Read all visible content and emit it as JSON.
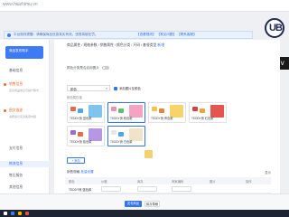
{
  "app": {
    "brand": "www.haizhimu.vn",
    "clock": ""
  },
  "notice": {
    "text": "平台规则提醒：请确保商品信息真实有效，违规将被处罚。",
    "links": "【查看规则】 【常见问题】 【联系客服】"
  },
  "sidebar": {
    "shop_card": "商品发布助手",
    "items": [
      {
        "label": "基础信息",
        "kind": "cat"
      },
      {
        "label": "销售信息",
        "kind": "cat"
      },
      {
        "label": "图文描述",
        "kind": "cat"
      },
      {
        "label": "支付信息",
        "kind": "normal"
      },
      {
        "label": "物流信息",
        "kind": "active"
      },
      {
        "label": "售后服务",
        "kind": "normal"
      },
      {
        "label": "其他信息",
        "kind": "normal"
      }
    ],
    "note1": "完善商品信息可提升曝光",
    "note2": "请按提示完善各项内容"
  },
  "main": {
    "tabs_text": "商品属性 / 规格参数 / 销售属性 / 颜色分类 / 尺码 / 套餐类型",
    "tabs_tag": "新增",
    "row1_label": "颜色分类是否启用图片",
    "select_value": "颜色",
    "checkbox_label": "添加图片至颜色",
    "row2_label": "颜色属性值",
    "cards": [
      {
        "label": "TEDDY熊 蓝色款"
      },
      {
        "label": "TEDDY熊 粉色款"
      },
      {
        "label": "TEDDY熊 黄色款"
      },
      {
        "label": "TEDDY熊 红色款"
      },
      {
        "label": "TEDDY熊 紫色款"
      },
      {
        "label": "TEDDY熊 白色款"
      }
    ],
    "add_button": "+ 添加",
    "spec_prefix": "销售规格",
    "spec_blue": "批量设置",
    "spec_right": "显示",
    "table_headers": [
      "颜色",
      "价格",
      "库存",
      "商家编码",
      "图片",
      "操作"
    ],
    "table_row": [
      "TEDDY熊 蓝色款",
      "",
      "",
      "",
      "",
      ""
    ]
  },
  "footer": {
    "primary": "发布商品",
    "secondary": "保存草稿"
  },
  "watermark": {
    "logo_text": "UB",
    "side_text": "rainv"
  },
  "colors": {
    "accent": "#3373f5",
    "category": "#f06a2a",
    "taskbar": "#1f2433"
  }
}
